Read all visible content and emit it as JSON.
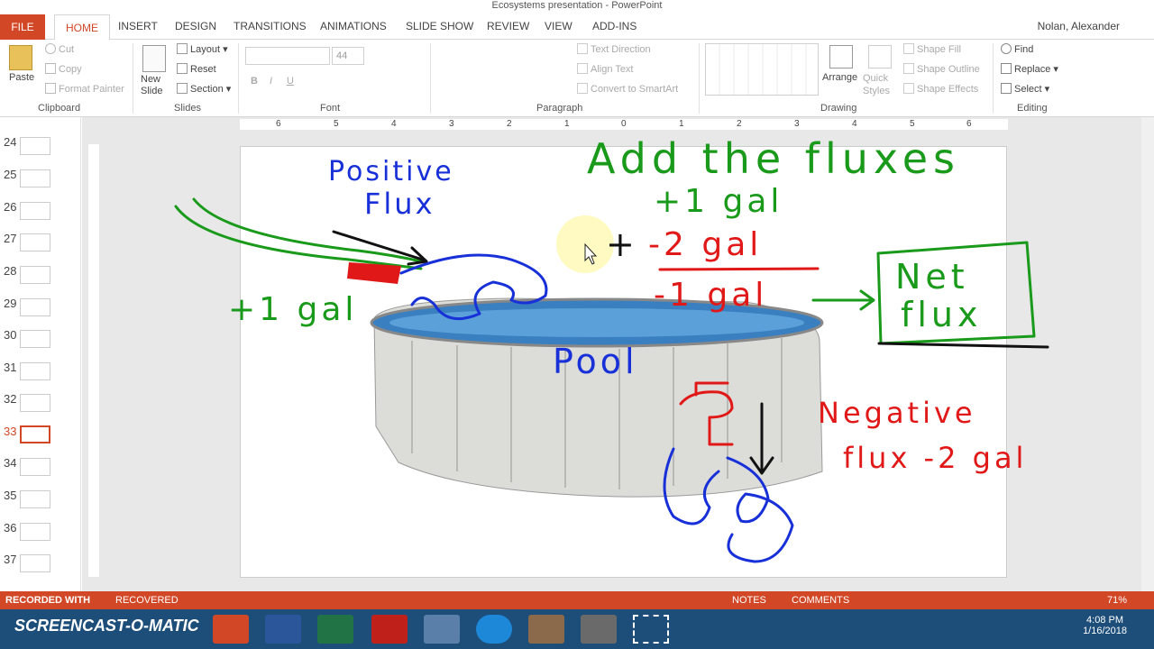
{
  "window": {
    "title": "Ecosystems presentation - PowerPoint",
    "user": "Nolan, Alexander"
  },
  "tabs": [
    "FILE",
    "HOME",
    "INSERT",
    "DESIGN",
    "TRANSITIONS",
    "ANIMATIONS",
    "SLIDE SHOW",
    "REVIEW",
    "VIEW",
    "ADD-INS"
  ],
  "ribbon": {
    "clipboard": {
      "paste": "Paste",
      "cut": "Cut",
      "copy": "Copy",
      "format_painter": "Format Painter",
      "label": "Clipboard"
    },
    "slides": {
      "new_slide": "New Slide",
      "layout": "Layout",
      "reset": "Reset",
      "section": "Section",
      "label": "Slides"
    },
    "font": {
      "size": "44",
      "label": "Font"
    },
    "paragraph": {
      "text_direction": "Text Direction",
      "align_text": "Align Text",
      "convert_smartart": "Convert to SmartArt",
      "label": "Paragraph"
    },
    "drawing": {
      "arrange": "Arrange",
      "quick_styles": "Quick Styles",
      "shape_fill": "Shape Fill",
      "shape_outline": "Shape Outline",
      "shape_effects": "Shape Effects",
      "label": "Drawing"
    },
    "editing": {
      "find": "Find",
      "replace": "Replace",
      "select": "Select",
      "label": "Editing"
    }
  },
  "ruler": {
    "ticks": [
      "6",
      "5",
      "4",
      "3",
      "2",
      "1",
      "0",
      "1",
      "2",
      "3",
      "4",
      "5",
      "6"
    ]
  },
  "slide_numbers": [
    "24",
    "25",
    "26",
    "27",
    "28",
    "29",
    "30",
    "31",
    "32",
    "33",
    "34",
    "35",
    "36",
    "37"
  ],
  "active_slide": "33",
  "slide": {
    "pool_label": "Pool",
    "positive_title": "Positive",
    "positive_title2": "Flux",
    "plus_one_left": "+1 gal",
    "heading": "Add the fluxes",
    "line1": "+1 gal",
    "line2": "-2 gal",
    "result": "-1 gal",
    "plus_sign": "+",
    "net_flux": "Net",
    "net_flux2": "flux",
    "negative": "Negative",
    "negative2": "flux -2 gal"
  },
  "status": {
    "recorded": "RECORDED WITH",
    "recovered": "RECOVERED",
    "notes": "NOTES",
    "comments": "COMMENTS",
    "zoom": "71%"
  },
  "taskbar": {
    "brand": "SCREENCAST-O-MATIC",
    "time": "4:08 PM",
    "date": "1/16/2018"
  },
  "colors": {
    "accent": "#d24726",
    "ink_green": "#1a9a1a",
    "ink_blue": "#1830d8",
    "ink_red": "#e01818",
    "ink_black": "#111111"
  }
}
